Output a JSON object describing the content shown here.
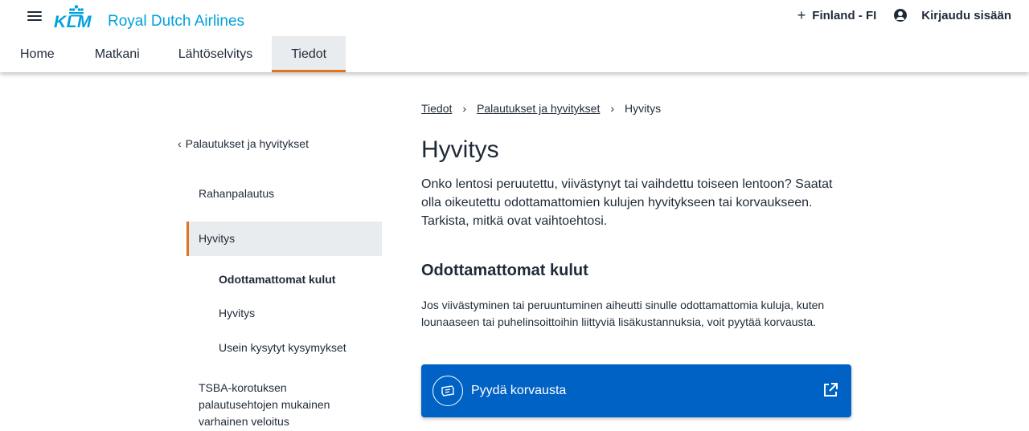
{
  "header": {
    "logo_text": "KLM",
    "brand_name": "Royal Dutch Airlines",
    "country": "Finland - FI",
    "login": "Kirjaudu sisään"
  },
  "nav": {
    "tabs": [
      {
        "label": "Home"
      },
      {
        "label": "Matkani"
      },
      {
        "label": "Lähtöselvitys"
      },
      {
        "label": "Tiedot",
        "active": true
      }
    ]
  },
  "sidebar": {
    "back_label": "Palautukset ja hyvitykset",
    "items": [
      {
        "label": "Rahanpalautus"
      },
      {
        "label": "Hyvitys",
        "active": true
      },
      {
        "label": "TSBA-korotuksen palautusehtojen mukainen varhainen veloitus"
      }
    ],
    "subitems": [
      {
        "label": "Odottamattomat kulut",
        "active": true
      },
      {
        "label": "Hyvitys"
      },
      {
        "label": "Usein kysytyt kysymykset"
      }
    ]
  },
  "breadcrumb": {
    "items": [
      "Tiedot",
      "Palautukset ja hyvitykset",
      "Hyvitys"
    ]
  },
  "main": {
    "title": "Hyvitys",
    "intro": "Onko lentosi peruutettu, viivästynyt tai vaihdettu toiseen lentoon? Saatat olla oikeutettu odottamattomien kulujen hyvitykseen tai korvaukseen. Tarkista, mitkä ovat vaihtoehtosi.",
    "section_title": "Odottamattomat kulut",
    "section_text": "Jos viivästyminen tai peruuntuminen aiheutti sinulle odottamattomia kuluja, kuten lounaaseen tai puhelinsoittoihin liittyviä lisäkustannuksia, voit pyytää korvausta.",
    "cta_label": "Pyydä korvausta"
  },
  "colors": {
    "brand_blue": "#00a1de",
    "cta_blue": "#0062c4",
    "accent_orange": "#e37222",
    "text_dark": "#1f2a38"
  },
  "icons": [
    "menu-icon",
    "plus-icon",
    "user-icon",
    "chevron-left-icon",
    "chevron-right-icon",
    "ticket-icon",
    "external-link-icon"
  ]
}
